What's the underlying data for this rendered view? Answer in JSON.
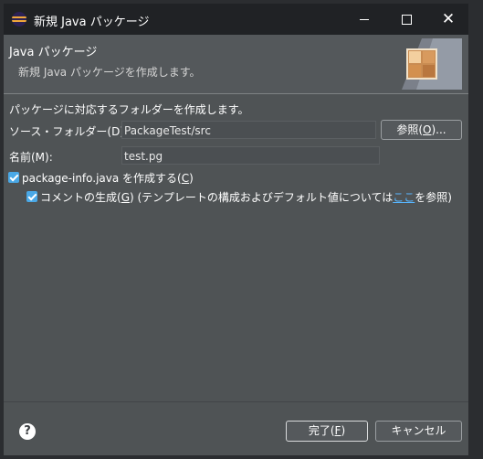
{
  "window": {
    "title": "新規 Java パッケージ",
    "controls": [
      "minimize-icon",
      "maximize-icon",
      "close-icon"
    ]
  },
  "header": {
    "title": "Java パッケージ",
    "description": "新規 Java パッケージを作成します。"
  },
  "form": {
    "instruction": "パッケージに対応するフォルダーを作成します。",
    "source_folder": {
      "label": "ソース・フォルダー(D):",
      "value": "PackageTest/src",
      "browse_label_pre": "参照(",
      "browse_mnemonic": "O",
      "browse_label_post": ")..."
    },
    "name": {
      "label": "名前(M):",
      "value": "test.pg"
    },
    "package_info": {
      "checked": true,
      "label_pre": "package-info.java を作成する(",
      "mnemonic": "C",
      "label_post": ")"
    },
    "comments": {
      "checked": true,
      "label_pre": "コメントの生成(",
      "mnemonic": "G",
      "label_mid": ") (テンプレートの構成およびデフォルト値については",
      "link": "ここ",
      "label_post": "を参照)"
    }
  },
  "footer": {
    "finish_label_pre": "完了(",
    "finish_mnemonic": "F",
    "finish_label_post": ")",
    "cancel_label": "キャンセル",
    "help_symbol": "?"
  },
  "colors": {
    "accent": "#4aa8e6",
    "link": "#58b6ff",
    "dialog_bg": "#4f5355",
    "titlebar_bg": "#202225"
  }
}
